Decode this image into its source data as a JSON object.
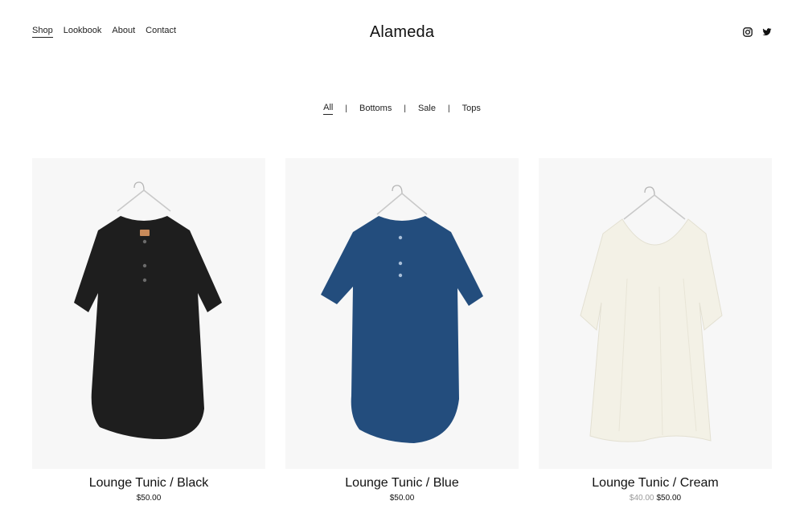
{
  "header": {
    "nav": [
      {
        "label": "Shop",
        "active": true
      },
      {
        "label": "Lookbook"
      },
      {
        "label": "About"
      },
      {
        "label": "Contact"
      }
    ],
    "title": "Alameda",
    "social": [
      "instagram-icon",
      "twitter-icon"
    ]
  },
  "filters": {
    "items": [
      {
        "label": "All",
        "active": true
      },
      {
        "label": "Bottoms"
      },
      {
        "label": "Sale"
      },
      {
        "label": "Tops"
      }
    ],
    "separator": "|"
  },
  "products": [
    {
      "name": "Lounge Tunic / Black",
      "price": "$50.00",
      "color": "#1e1e1e"
    },
    {
      "name": "Lounge Tunic / Blue",
      "price": "$50.00",
      "color": "#234d7d"
    },
    {
      "name": "Lounge Tunic / Cream",
      "old_price": "$40.00",
      "price": "$50.00",
      "color": "#f3f1e6"
    }
  ]
}
